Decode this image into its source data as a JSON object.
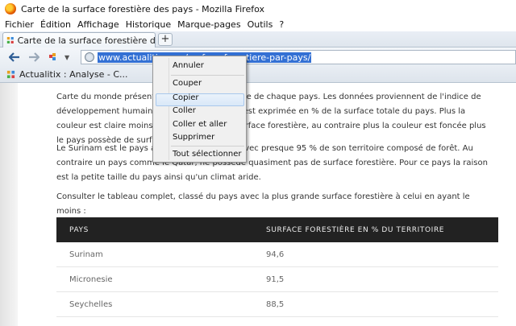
{
  "window": {
    "title": "Carte de la surface forestière des pays - Mozilla Firefox"
  },
  "menu": {
    "items": [
      "Fichier",
      "Édition",
      "Affichage",
      "Historique",
      "Marque-pages",
      "Outils",
      "?"
    ]
  },
  "tab": {
    "title": "Carte de la surface forestière des pays",
    "new_tab_label": "+"
  },
  "nav": {
    "back": "◀",
    "forward": "▶",
    "url": "www.actualitix.com/surface-forestiere-par-pays/"
  },
  "bookmarks": {
    "item": "Actualitix : Analyse - C..."
  },
  "content": {
    "para1": "Carte du monde présentant la surface forestière de chaque pays. Les données proviennent de l'indice de développement humain. La surface forestière est exprimée en % de la surface totale du pays. Plus la couleur est claire moins le pays possède de surface forestière, au contraire plus la couleur est foncée plus le pays possède de surface.",
    "para2": "Le Surinam est le pays ayant le plus de forêt avec presque 95 % de son territoire composé de forêt. Au contraire un pays comme le Qatar, ne possède quasiment pas de surface forestière. Pour ce pays la raison est la petite taille du pays ainsi qu'un climat aride.",
    "para3": "Consulter le tableau complet, classé du pays avec la plus grande surface forestière à celui en ayant le moins :",
    "table": {
      "headers": [
        "PAYS",
        "SURFACE FORESTIÈRE EN % DU TERRITOIRE"
      ],
      "rows": [
        [
          "Surinam",
          "94,6"
        ],
        [
          "Micronesie",
          "91,5"
        ],
        [
          "Seychelles",
          "88,5"
        ]
      ]
    }
  },
  "context_menu": {
    "items": [
      "Annuler",
      "Couper",
      "Copier",
      "Coller",
      "Coller et aller",
      "Supprimer",
      "Tout sélectionner"
    ]
  }
}
